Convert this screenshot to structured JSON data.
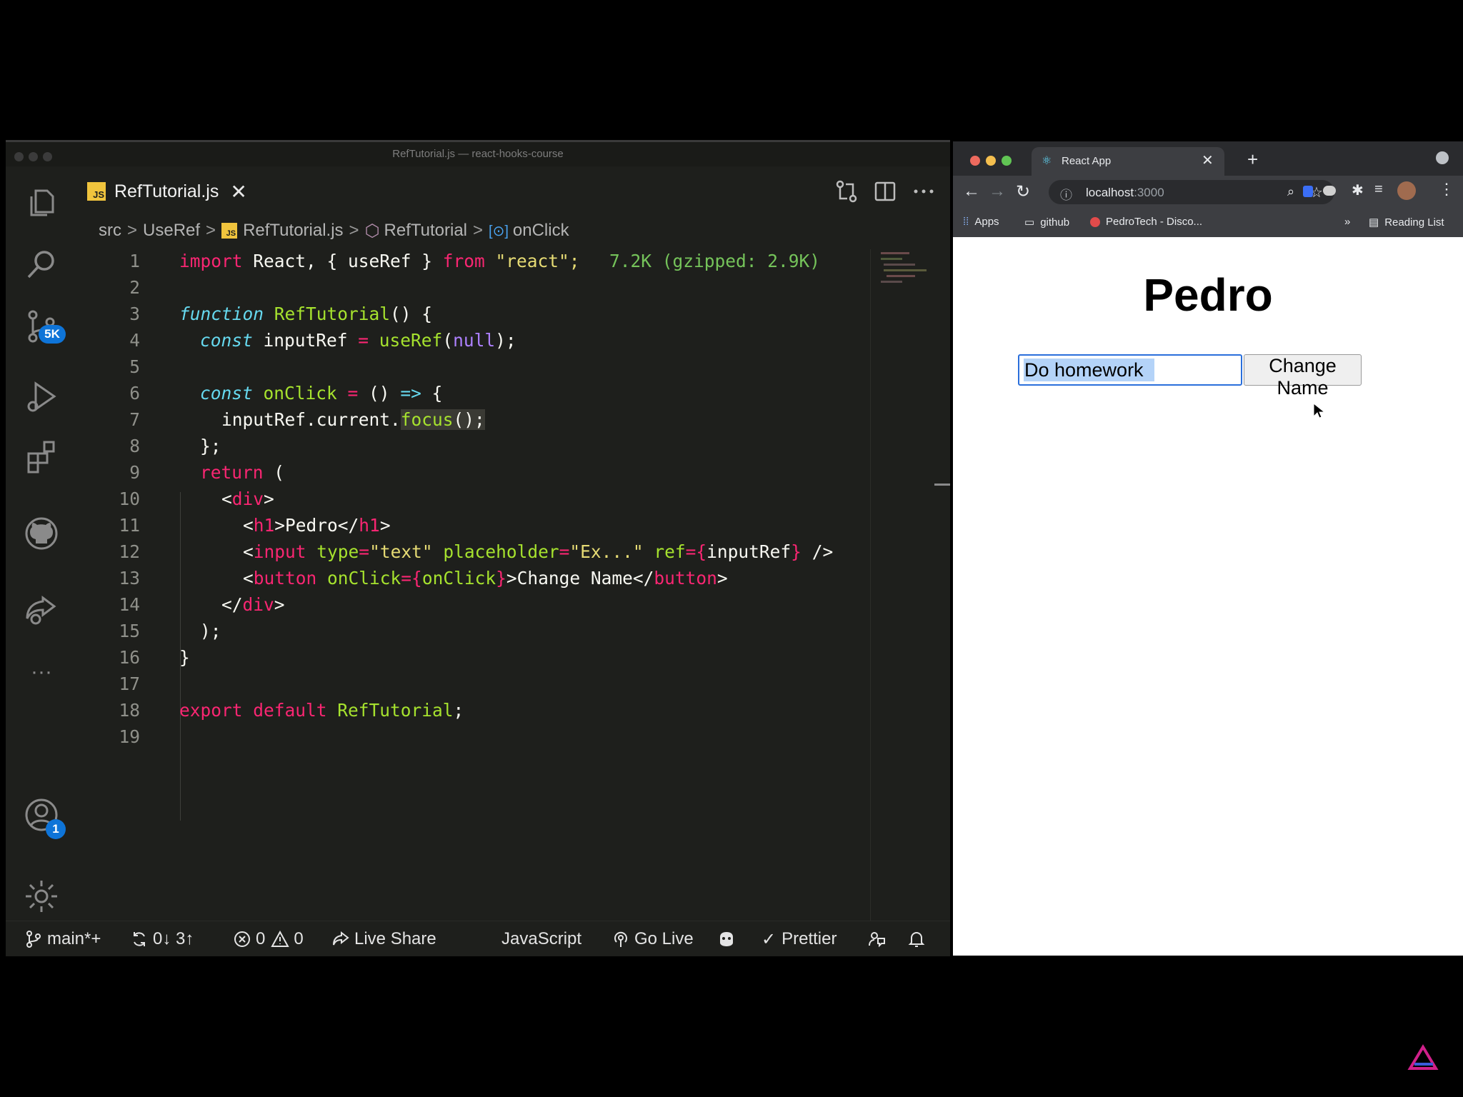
{
  "vscode": {
    "window_title": "RefTutorial.js — react-hooks-course",
    "tab": {
      "icon_text": "JS",
      "label": "RefTutorial.js",
      "close": "✕"
    },
    "breadcrumb": [
      "src",
      "UseRef",
      "RefTutorial.js",
      "RefTutorial",
      "onClick"
    ],
    "activity_badges": {
      "source_control": "5K",
      "accounts": "1"
    },
    "line_numbers": [
      "1",
      "2",
      "3",
      "4",
      "5",
      "6",
      "7",
      "8",
      "9",
      "10",
      "11",
      "12",
      "13",
      "14",
      "15",
      "16",
      "17",
      "18",
      "19"
    ],
    "code": {
      "l1": {
        "import": "import",
        "mid": " React, { useRef } ",
        "from": "from",
        "str": " \"react\";",
        "size": "7.2K (gzipped: 2.9K)"
      },
      "l3": {
        "kw": "function",
        "fn": " RefTutorial",
        "rest": "() {"
      },
      "l4": {
        "kw": "const",
        "var": " inputRef ",
        "eq": "=",
        "fn": " useRef",
        "p1": "(",
        "nu": "null",
        "p2": ");"
      },
      "l6": {
        "kw": "const",
        "fn": " onClick",
        "eq": " =",
        "rest1": " () ",
        "arrow": "=>",
        "rest2": " {"
      },
      "l7": {
        "a": "inputRef.current.",
        "fn": "focus",
        "b": "();"
      },
      "l8": "};",
      "l9": {
        "kw": "return",
        "rest": " ("
      },
      "l10": {
        "lt": "<",
        "tag": "div",
        "gt": ">"
      },
      "l11": {
        "lt": "<",
        "tag": "h1",
        "mid": ">Pedro</",
        "tag2": "h1",
        "gt": ">"
      },
      "l12": {
        "lt": "<",
        "tag": "input",
        "a1": " type",
        "e1": "=",
        "s1": "\"text\"",
        "a2": " placeholder",
        "e2": "=",
        "s2": "\"Ex...\"",
        "a3": " ref",
        "e3": "={",
        "v": "inputRef",
        "e4": "}",
        "end": " />"
      },
      "l13": {
        "lt": "<",
        "tag": "button",
        "a1": " onClick",
        "e1": "={",
        "v": "onClick",
        "e2": "}",
        "mid": ">Change Name</",
        "tag2": "button",
        "gt": ">"
      },
      "l14": {
        "lt": "</",
        "tag": "div",
        "gt": ">"
      },
      "l15": ");",
      "l16": "}",
      "l18": {
        "kw1": "export",
        "kw2": " default",
        "fn": " RefTutorial",
        "rest": ";"
      }
    },
    "status": {
      "branch": "main*+",
      "sync": "0↓ 3↑",
      "errors": "0",
      "warnings": "0",
      "live_share": "Live Share",
      "language": "JavaScript",
      "go_live": "Go Live",
      "prettier": "Prettier"
    }
  },
  "chrome": {
    "tab_title": "React App",
    "tab_close": "✕",
    "new_tab": "+",
    "url_host": "localhost",
    "url_port": ":3000",
    "bookmarks": {
      "apps": "Apps",
      "github": "github",
      "pedrotech": "PedroTech - Disco...",
      "more": "»",
      "reading_list": "Reading List"
    },
    "page": {
      "heading": "Pedro",
      "input_value": "Do homework",
      "button_label": "Change Name"
    }
  },
  "colors": {
    "vscode_bg": "#1e1f1c",
    "keyword": "#f92672",
    "function": "#a6e22e",
    "string": "#e6db74",
    "storage": "#66d9ef",
    "focus_ring": "#2a6fdb"
  }
}
